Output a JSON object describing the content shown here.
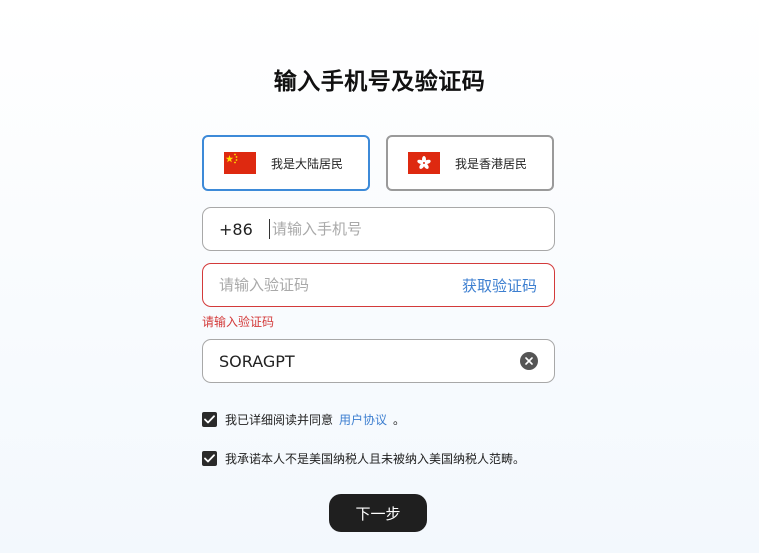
{
  "title": "输入手机号及验证码",
  "residency": {
    "mainland_label": "我是大陆居民",
    "hk_label": "我是香港居民",
    "selected": "mainland"
  },
  "phone": {
    "prefix": "+86",
    "placeholder": "请输入手机号",
    "value": ""
  },
  "code": {
    "placeholder": "请输入验证码",
    "value": "",
    "get_code_label": "获取验证码",
    "error": "请输入验证码"
  },
  "invite": {
    "value": "SORAGPT"
  },
  "agreements": {
    "read_prefix": "我已详细阅读并同意",
    "read_link": "用户协议",
    "read_suffix": "。",
    "read_checked": true,
    "tax_text": "我承诺本人不是美国纳税人且未被纳入美国纳税人范畴。",
    "tax_checked": true
  },
  "next_label": "下一步",
  "colors": {
    "accent": "#3d7fd0",
    "error": "#d33a3a",
    "button_bg": "#1f1f1f"
  },
  "icons": {
    "mainland": "china-flag-icon",
    "hk": "hong-kong-flag-icon",
    "clear": "clear-icon",
    "check": "check-icon"
  }
}
